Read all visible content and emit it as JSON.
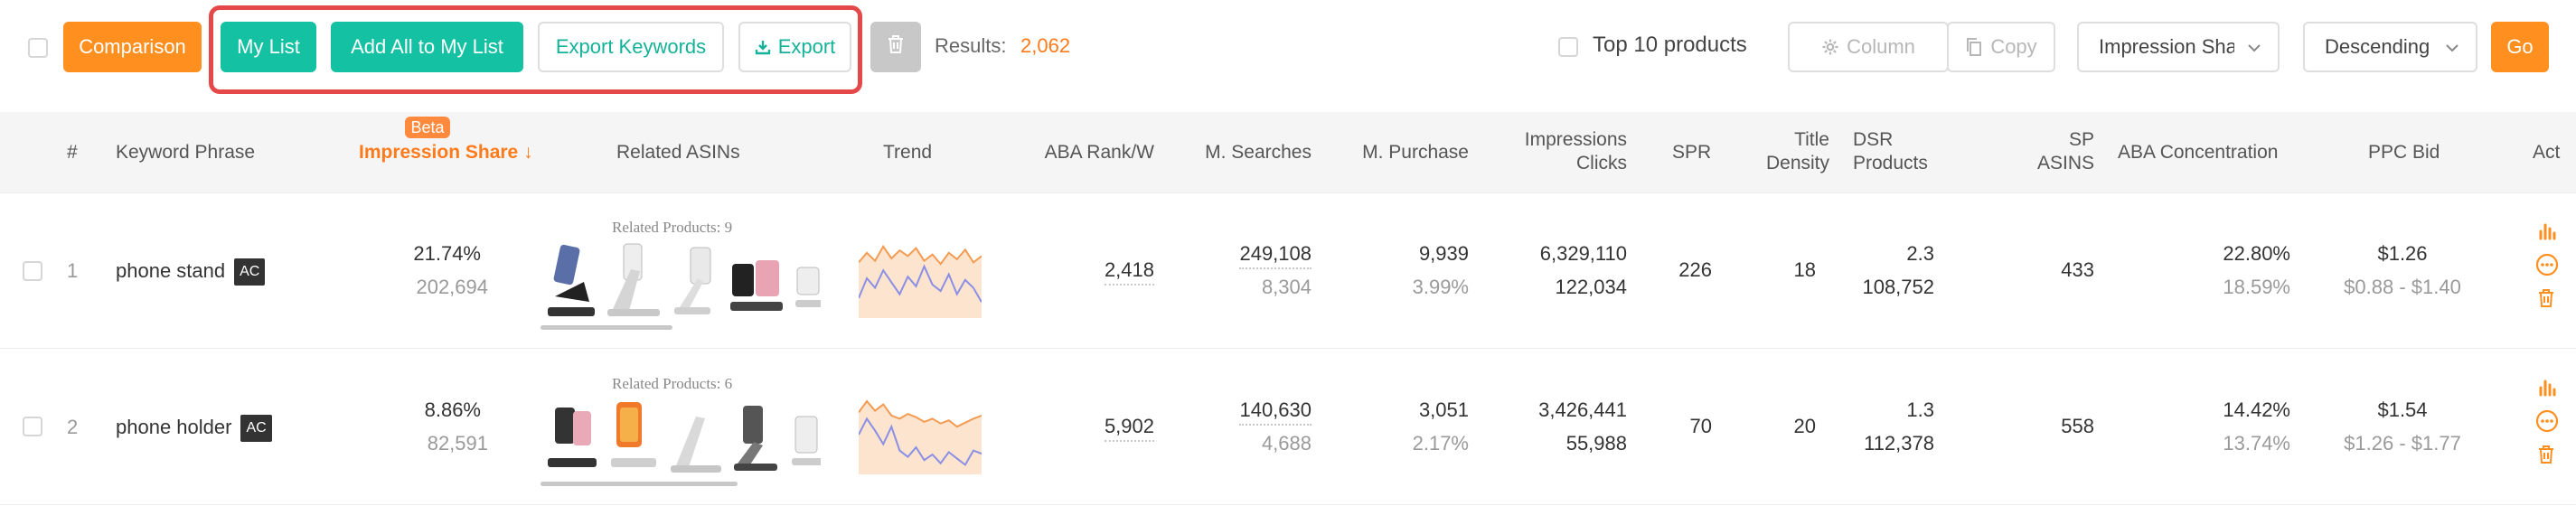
{
  "toolbar": {
    "comparison_label": "Comparison",
    "my_list_label": "My List",
    "add_all_label": "Add All to My List",
    "export_keywords_label": "Export Keywords",
    "export_label": "Export",
    "results_label": "Results:",
    "results_value": "2,062",
    "top10_label": "Top 10 products",
    "column_label": "Column",
    "copy_label": "Copy",
    "sort_field_value": "Impression Share",
    "sort_order_value": "Descending",
    "go_label": "Go"
  },
  "colors": {
    "accent_orange": "#ff8f1f",
    "accent_teal": "#14c2a3",
    "highlight_red": "#e54848",
    "trend_orange": "#f39b52",
    "trend_purple": "#8a8fe6"
  },
  "table": {
    "beta_badge": "Beta",
    "headers": {
      "index": "#",
      "keyword": "Keyword Phrase",
      "impression_share": "Impression Share",
      "sort_arrow": "↓",
      "related_asins": "Related ASINs",
      "trend": "Trend",
      "aba_rank": "ABA Rank/W",
      "m_searches": "M. Searches",
      "m_purchase": "M. Purchase",
      "impressions_line1": "Impressions",
      "impressions_line2": "Clicks",
      "spr": "SPR",
      "title_density_line1": "Title",
      "title_density_line2": "Density",
      "dsr_line1": "DSR",
      "dsr_line2": "Products",
      "sp_line1": "SP",
      "sp_line2": "ASINS",
      "aba_concentration": "ABA Concentration",
      "ppc_bid": "PPC Bid",
      "actions": "Act"
    },
    "rows": [
      {
        "index": "1",
        "keyword": "phone stand",
        "badge": "AC",
        "impression_share": "21.74%",
        "impression_count": "202,694",
        "related_label": "Related Products: 9",
        "aba_rank": "2,418",
        "m_searches": "249,108",
        "m_searches_sub": "8,304",
        "m_purchase": "9,939",
        "m_purchase_rate": "3.99%",
        "impressions": "6,329,110",
        "clicks": "122,034",
        "spr": "226",
        "title_density": "18",
        "dsr": "2.3",
        "dsr_products": "108,752",
        "sp_asins": "433",
        "aba_concentration": "22.80%",
        "aba_concentration_sub": "18.59%",
        "ppc_bid": "$1.26",
        "ppc_range": "$0.88 - $1.40",
        "trend": {
          "series_a": [
            0.3,
            0.18,
            0.28,
            0.1,
            0.25,
            0.15,
            0.22,
            0.12,
            0.28,
            0.2,
            0.32,
            0.18,
            0.26,
            0.14,
            0.3,
            0.22
          ],
          "series_b": [
            0.75,
            0.5,
            0.62,
            0.4,
            0.55,
            0.7,
            0.48,
            0.6,
            0.35,
            0.58,
            0.66,
            0.45,
            0.7,
            0.52,
            0.62,
            0.8
          ]
        }
      },
      {
        "index": "2",
        "keyword": "phone holder",
        "badge": "AC",
        "impression_share": "8.86%",
        "impression_count": "82,591",
        "related_label": "Related Products: 6",
        "aba_rank": "5,902",
        "m_searches": "140,630",
        "m_searches_sub": "4,688",
        "m_purchase": "3,051",
        "m_purchase_rate": "2.17%",
        "impressions": "3,426,441",
        "clicks": "55,988",
        "spr": "70",
        "title_density": "20",
        "dsr": "1.3",
        "dsr_products": "112,378",
        "sp_asins": "558",
        "aba_concentration": "14.42%",
        "aba_concentration_sub": "13.74%",
        "ppc_bid": "$1.54",
        "ppc_range": "$1.26 - $1.77",
        "trend": {
          "series_a": [
            0.22,
            0.08,
            0.2,
            0.12,
            0.26,
            0.3,
            0.24,
            0.28,
            0.34,
            0.3,
            0.36,
            0.32,
            0.4,
            0.35,
            0.3,
            0.26
          ],
          "series_b": [
            0.5,
            0.3,
            0.45,
            0.62,
            0.4,
            0.7,
            0.78,
            0.66,
            0.82,
            0.75,
            0.86,
            0.72,
            0.8,
            0.88,
            0.7,
            0.74
          ]
        }
      }
    ]
  }
}
